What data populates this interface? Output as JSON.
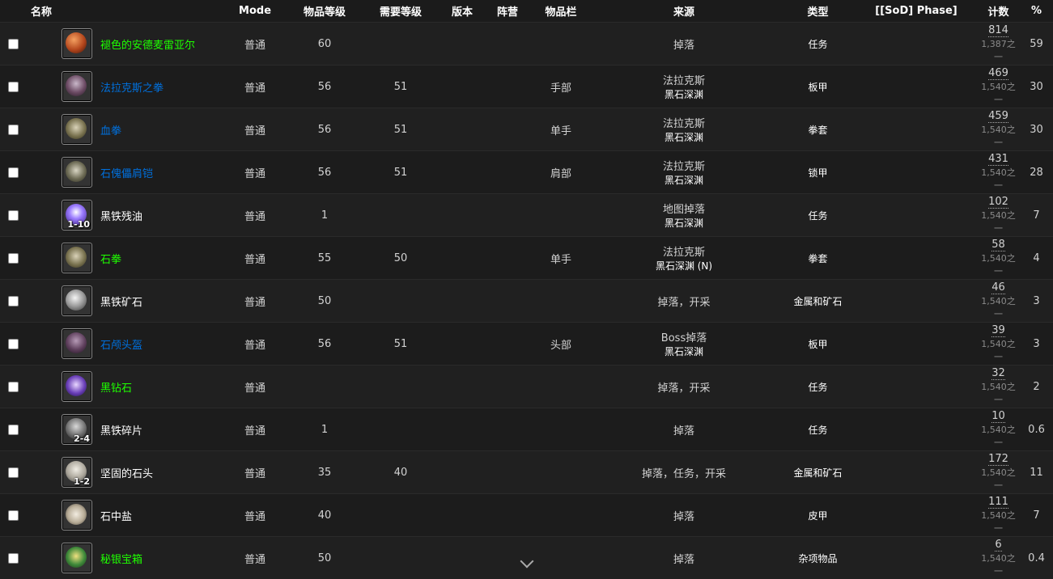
{
  "headers": {
    "name": "名称",
    "mode": "Mode",
    "item_level": "物品等级",
    "req_level": "需要等级",
    "version": "版本",
    "faction": "阵营",
    "slot": "物品栏",
    "source": "来源",
    "type": "类型",
    "phase": "[[SoD] Phase]",
    "count": "计数",
    "pct": "%"
  },
  "rows": [
    {
      "name": "褪色的安德麦雷亚尔",
      "quality": "green",
      "icon": "orange-orb-icon",
      "stack": "",
      "mode": "普通",
      "ilvl": "60",
      "req": "",
      "slot": "",
      "src1": "掉落",
      "src2": "",
      "type": "任务",
      "count": "814",
      "of": "1,387之一",
      "pct": "59"
    },
    {
      "name": "法拉克斯之拳",
      "quality": "blue",
      "icon": "plate-gauntlet-icon",
      "stack": "",
      "mode": "普通",
      "ilvl": "56",
      "req": "51",
      "slot": "手部",
      "src1": "法拉克斯",
      "src2": "黑石深渊",
      "type": "板甲",
      "count": "469",
      "of": "1,540之一",
      "pct": "30"
    },
    {
      "name": "血拳",
      "quality": "blue",
      "icon": "fist-weapon-icon",
      "stack": "",
      "mode": "普通",
      "ilvl": "56",
      "req": "51",
      "slot": "单手",
      "src1": "法拉克斯",
      "src2": "黑石深渊",
      "type": "拳套",
      "count": "459",
      "of": "1,540之一",
      "pct": "30"
    },
    {
      "name": "石傀儡肩铠",
      "quality": "blue",
      "icon": "shoulder-armor-icon",
      "stack": "",
      "mode": "普通",
      "ilvl": "56",
      "req": "51",
      "slot": "肩部",
      "src1": "法拉克斯",
      "src2": "黑石深渊",
      "type": "锁甲",
      "count": "431",
      "of": "1,540之一",
      "pct": "28"
    },
    {
      "name": "黑铁残油",
      "quality": "white",
      "icon": "purple-vial-icon",
      "stack": "1-10",
      "mode": "普通",
      "ilvl": "1",
      "req": "",
      "slot": "",
      "src1": "地图掉落",
      "src2": "黑石深渊",
      "type": "任务",
      "count": "102",
      "of": "1,540之一",
      "pct": "7"
    },
    {
      "name": "石拳",
      "quality": "green",
      "icon": "fist-weapon-icon",
      "stack": "",
      "mode": "普通",
      "ilvl": "55",
      "req": "50",
      "slot": "单手",
      "src1": "法拉克斯",
      "src2": "黑石深渊 (N)",
      "type": "拳套",
      "count": "58",
      "of": "1,540之一",
      "pct": "4"
    },
    {
      "name": "黑铁矿石",
      "quality": "white",
      "icon": "ore-icon",
      "stack": "",
      "mode": "普通",
      "ilvl": "50",
      "req": "",
      "slot": "",
      "src1": "掉落，开采",
      "src2": "",
      "type": "金属和矿石",
      "count": "46",
      "of": "1,540之一",
      "pct": "3"
    },
    {
      "name": "石颅头盔",
      "quality": "blue",
      "icon": "helmet-icon",
      "stack": "",
      "mode": "普通",
      "ilvl": "56",
      "req": "51",
      "slot": "头部",
      "src1": "Boss掉落",
      "src2": "黑石深渊",
      "type": "板甲",
      "count": "39",
      "of": "1,540之一",
      "pct": "3"
    },
    {
      "name": "黑钻石",
      "quality": "green",
      "icon": "diamond-icon",
      "stack": "",
      "mode": "普通",
      "ilvl": "",
      "req": "",
      "slot": "",
      "src1": "掉落，开采",
      "src2": "",
      "type": "任务",
      "count": "32",
      "of": "1,540之一",
      "pct": "2"
    },
    {
      "name": "黑铁碎片",
      "quality": "white",
      "icon": "iron-shard-icon",
      "stack": "2-4",
      "mode": "普通",
      "ilvl": "1",
      "req": "",
      "slot": "",
      "src1": "掉落",
      "src2": "",
      "type": "任务",
      "count": "10",
      "of": "1,540之一",
      "pct": "0.6"
    },
    {
      "name": "坚固的石头",
      "quality": "white",
      "icon": "stone-icon",
      "stack": "1-2",
      "mode": "普通",
      "ilvl": "35",
      "req": "40",
      "slot": "",
      "src1": "掉落，任务，开采",
      "src2": "",
      "type": "金属和矿石",
      "count": "172",
      "of": "1,540之一",
      "pct": "11"
    },
    {
      "name": "石中盐",
      "quality": "white",
      "icon": "salt-pile-icon",
      "stack": "",
      "mode": "普通",
      "ilvl": "40",
      "req": "",
      "slot": "",
      "src1": "掉落",
      "src2": "",
      "type": "皮甲",
      "count": "111",
      "of": "1,540之一",
      "pct": "7"
    },
    {
      "name": "秘银宝箱",
      "quality": "green",
      "icon": "treasure-chest-icon",
      "stack": "",
      "mode": "普通",
      "ilvl": "50",
      "req": "",
      "slot": "",
      "src1": "掉落",
      "src2": "",
      "type": "杂项物品",
      "count": "6",
      "of": "1,540之一",
      "pct": "0.4"
    }
  ],
  "colors": {
    "green": "#1eff00",
    "blue": "#0070dd",
    "white": "#ffffff"
  }
}
